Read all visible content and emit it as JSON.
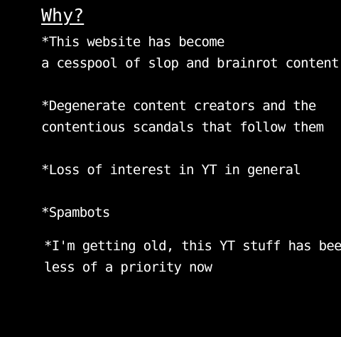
{
  "title": "Why?",
  "reasons": [
    {
      "lines": [
        "*This website has become",
        "a cesspool of slop and brainrot content"
      ]
    },
    {
      "lines": [
        "*Degenerate content creators and the",
        "contentious scandals that follow them"
      ]
    },
    {
      "lines": [
        "*Loss of interest in YT in general"
      ]
    },
    {
      "lines": [
        "*Spambots"
      ]
    },
    {
      "lines": [
        "*I'm getting old, this YT stuff has been",
        "less of a priority now"
      ]
    }
  ],
  "colors": {
    "background": "#000000",
    "text": "#ffffff"
  }
}
